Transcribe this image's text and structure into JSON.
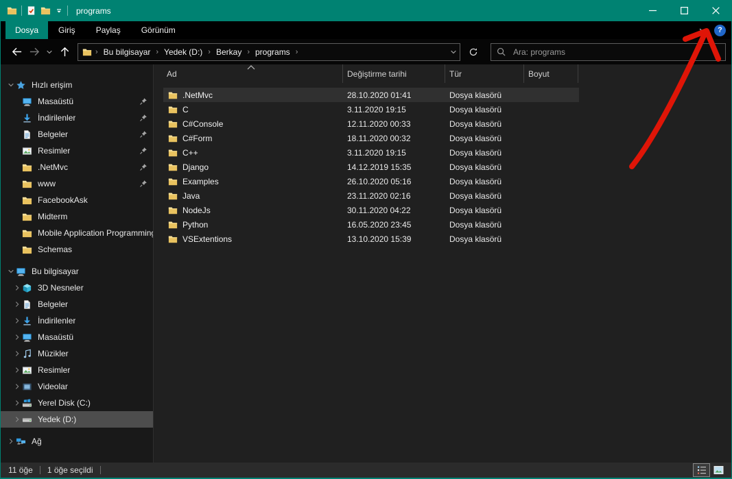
{
  "colors": {
    "accent": "#008272",
    "arrow_red": "#df1507",
    "folder_gold": "#e9c25f",
    "help_blue": "#2066c8"
  },
  "titlebar": {
    "title": "programs",
    "qat_icons": [
      "folder",
      "check-document",
      "folder",
      "qat-dropdown"
    ],
    "window_buttons": [
      "minimize",
      "maximize",
      "close"
    ]
  },
  "tabs": {
    "file_tab": "Dosya",
    "items": [
      "Giriş",
      "Paylaş",
      "Görünüm"
    ],
    "right_icons": [
      "ribbon-expand-chevron",
      "help"
    ]
  },
  "toolbar": {
    "nav_icons": [
      "back-arrow",
      "forward-arrow",
      "recent-locations-chevron",
      "up-arrow"
    ],
    "breadcrumb": [
      "Bu bilgisayar",
      "Yedek (D:)",
      "Berkay",
      "programs"
    ],
    "address_icons": [
      "folder",
      "history-chevron",
      "refresh"
    ],
    "search_placeholder": "Ara: programs"
  },
  "sidebar": {
    "sections": [
      {
        "label": "Hızlı erişim",
        "icon": "star",
        "expanded": true,
        "items": [
          {
            "label": "Masaüstü",
            "icon": "monitor",
            "pinned": true
          },
          {
            "label": "İndirilenler",
            "icon": "download",
            "pinned": true
          },
          {
            "label": "Belgeler",
            "icon": "document",
            "pinned": true
          },
          {
            "label": "Resimler",
            "icon": "picture",
            "pinned": true
          },
          {
            "label": ".NetMvc",
            "icon": "folder",
            "pinned": true
          },
          {
            "label": "www",
            "icon": "folder",
            "pinned": true
          },
          {
            "label": "FacebookAsk",
            "icon": "folder",
            "pinned": false
          },
          {
            "label": "Midterm",
            "icon": "folder",
            "pinned": false
          },
          {
            "label": "Mobile Application Programming",
            "icon": "folder",
            "pinned": false
          },
          {
            "label": "Schemas",
            "icon": "folder",
            "pinned": false
          }
        ]
      },
      {
        "label": "Bu bilgisayar",
        "icon": "monitor",
        "expanded": true,
        "items": [
          {
            "label": "3D Nesneler",
            "icon": "cube",
            "chevron": true
          },
          {
            "label": "Belgeler",
            "icon": "document",
            "chevron": true
          },
          {
            "label": "İndirilenler",
            "icon": "download",
            "chevron": true
          },
          {
            "label": "Masaüstü",
            "icon": "monitor",
            "chevron": true
          },
          {
            "label": "Müzikler",
            "icon": "music",
            "chevron": true
          },
          {
            "label": "Resimler",
            "icon": "picture",
            "chevron": true
          },
          {
            "label": "Videolar",
            "icon": "video",
            "chevron": true
          },
          {
            "label": "Yerel Disk (C:)",
            "icon": "disk-os",
            "chevron": true
          },
          {
            "label": "Yedek (D:)",
            "icon": "disk",
            "chevron": true,
            "selected": true
          }
        ]
      },
      {
        "label": "Ağ",
        "icon": "network",
        "expanded": false,
        "items": []
      }
    ]
  },
  "files": {
    "columns": [
      "Ad",
      "Değiştirme tarihi",
      "Tür",
      "Boyut"
    ],
    "sort_column": "Ad",
    "rows": [
      {
        "name": ".NetMvc",
        "modified": "28.10.2020 01:41",
        "type": "Dosya klasörü",
        "size": "",
        "selected": true
      },
      {
        "name": "C",
        "modified": "3.11.2020 19:15",
        "type": "Dosya klasörü",
        "size": ""
      },
      {
        "name": "C#Console",
        "modified": "12.11.2020 00:33",
        "type": "Dosya klasörü",
        "size": ""
      },
      {
        "name": "C#Form",
        "modified": "18.11.2020 00:32",
        "type": "Dosya klasörü",
        "size": ""
      },
      {
        "name": "C++",
        "modified": "3.11.2020 19:15",
        "type": "Dosya klasörü",
        "size": ""
      },
      {
        "name": "Django",
        "modified": "14.12.2019 15:35",
        "type": "Dosya klasörü",
        "size": ""
      },
      {
        "name": "Examples",
        "modified": "26.10.2020 05:16",
        "type": "Dosya klasörü",
        "size": ""
      },
      {
        "name": "Java",
        "modified": "23.11.2020 02:16",
        "type": "Dosya klasörü",
        "size": ""
      },
      {
        "name": "NodeJs",
        "modified": "30.11.2020 04:22",
        "type": "Dosya klasörü",
        "size": ""
      },
      {
        "name": "Python",
        "modified": "16.05.2020 23:45",
        "type": "Dosya klasörü",
        "size": ""
      },
      {
        "name": "VSExtentions",
        "modified": "13.10.2020 15:39",
        "type": "Dosya klasörü",
        "size": ""
      }
    ]
  },
  "statusbar": {
    "item_count": "11 öğe",
    "selected_count": "1 öğe seçildi",
    "view_buttons": [
      "details-view",
      "thumbnails-view"
    ]
  },
  "annotation": {
    "shape": "hand-drawn red arrow",
    "points_to": "ribbon-expand-chevron",
    "color": "#df1507"
  }
}
